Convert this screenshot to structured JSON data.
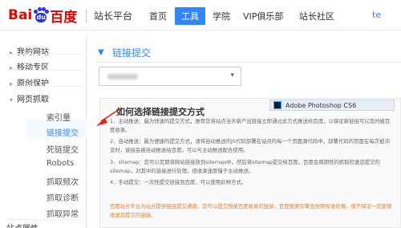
{
  "header": {
    "logo": {
      "bai": "Bai",
      "du": "du",
      "cn": "百度"
    },
    "site_title": "站长平台",
    "nav": [
      {
        "label": "首页",
        "active": false
      },
      {
        "label": "工具",
        "active": true
      },
      {
        "label": "学院",
        "active": false
      },
      {
        "label": "VIP俱乐部",
        "active": false
      },
      {
        "label": "站长社区",
        "active": false
      }
    ],
    "user_link": "te"
  },
  "sidebar": {
    "groups": [
      {
        "label": "我的网站",
        "expanded": false
      },
      {
        "label": "移动专区",
        "expanded": false
      },
      {
        "label": "原创保护",
        "expanded": false
      },
      {
        "label": "网页抓取",
        "expanded": true
      }
    ],
    "sub_items": [
      {
        "label": "索引量",
        "active": false
      },
      {
        "label": "链接提交",
        "active": true
      },
      {
        "label": "死链提交",
        "active": false
      },
      {
        "label": "Robots",
        "active": false
      },
      {
        "label": "抓取频次",
        "active": false
      },
      {
        "label": "抓取诊断",
        "active": false
      },
      {
        "label": "抓取异常",
        "active": false
      }
    ],
    "bottom_partial": "站点属性"
  },
  "main": {
    "title": "链接提交",
    "site_select": {
      "value": ""
    },
    "panel": {
      "title": "如何选择链接提交方式",
      "paragraphs": [
        "1．主动推送：最为快速的提交方式，推荐您将站点当天新产出链接立即通过此方式推送给百度，以保证新链接可以及时被百度收录。",
        "2．自动推送：最为便捷的提交方式，请将自动推送的JS代码部署在站点的每一个页面源代码中，部署代码的页面在每次被浏览时，链接会被自动推送给百度。可以与主动推送配合使用。",
        "3．sitemap：您可以定期将网站链接放到sitemap中，然后将sitemap提交给百度。百度会周期性的抓取检查您提交的sitemap，对其中的链接进行处理，但收录速度慢于主动推送。",
        "4．手动提交：一次性提交链接到百度，可以使用此种方式。"
      ],
      "note": "百度站长平台为站长提供链接提交通道，您可以提交想被百度收录的链接，百度搜索引擎会按照标准处理，但不保证一定能够收录您提交的链接。"
    },
    "overlay_chip": "Adobe Photoshop CS6"
  },
  "colors": {
    "accent": "#3385ff",
    "logo_red": "#e10602",
    "logo_blue": "#2932e1",
    "annotation_red": "#e8211b",
    "note_orange": "#e07b2c"
  }
}
